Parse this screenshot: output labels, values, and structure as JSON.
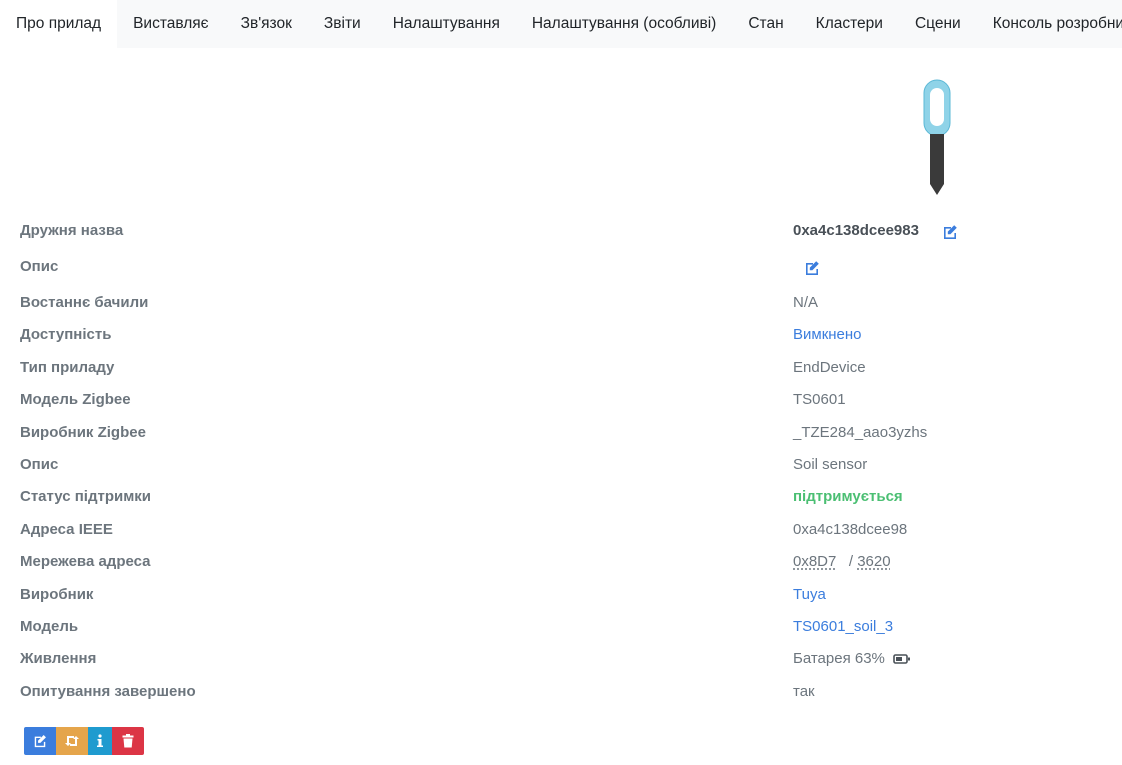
{
  "tabs": [
    {
      "label": "Про прилад",
      "active": true
    },
    {
      "label": "Виставляє"
    },
    {
      "label": "Зв'язок"
    },
    {
      "label": "Звіти"
    },
    {
      "label": "Налаштування"
    },
    {
      "label": "Налаштування (особливі)"
    },
    {
      "label": "Стан"
    },
    {
      "label": "Кластери"
    },
    {
      "label": "Сцени"
    },
    {
      "label": "Консоль розробника"
    }
  ],
  "device": {
    "image_icon": "soil-sensor-device-image",
    "friendly_name_label": "Дружня назва",
    "friendly_name": "0xa4c138dcee983",
    "description_label": "Опис",
    "last_seen_label": "Востаннє бачили",
    "last_seen": "N/A",
    "availability_label": "Доступність",
    "availability": "Вимкнено",
    "device_type_label": "Тип приладу",
    "device_type": "EndDevice",
    "zigbee_model_label": "Модель Zigbee",
    "zigbee_model": "TS0601",
    "zigbee_manufacturer_label": "Виробник Zigbee",
    "zigbee_manufacturer": "_TZE284_aao3yzhs",
    "description2_label": "Опис",
    "description2": "Soil sensor",
    "support_status_label": "Статус підтримки",
    "support_status": "підтримується",
    "ieee_label": "Адреса IEEE",
    "ieee": "0xa4c138dcee98",
    "network_address_label": "Мережева адреса",
    "network_hex": "0x8D7",
    "network_sep": "/",
    "network_dec": "3620",
    "manufacturer_label": "Виробник",
    "manufacturer": "Tuya",
    "model_label": "Модель",
    "model": "TS0601_soil_3",
    "power_label": "Живлення",
    "power": "Батарея 63%",
    "interview_label": "Опитування завершено",
    "interview": "так"
  },
  "colors": {
    "link": "#3b7ddd",
    "supported": "#4bbf73",
    "rename_button": "#3b7ddd",
    "reconfigure_button": "#e5a54b",
    "interview_button": "#1f9bcf",
    "remove_button": "#dc3545"
  }
}
